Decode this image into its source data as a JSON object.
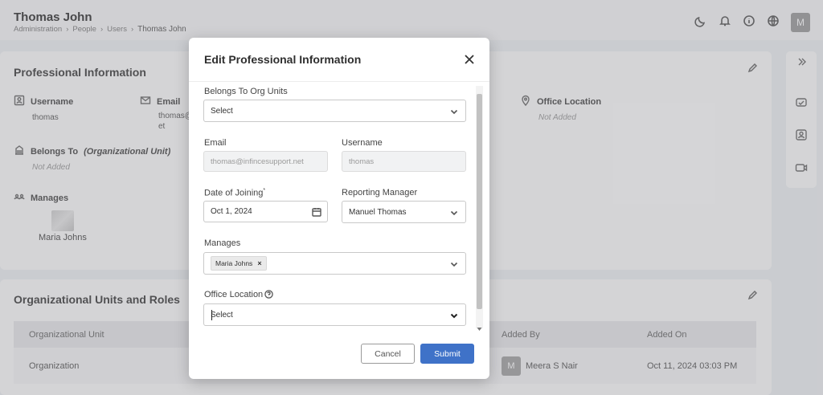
{
  "header": {
    "title": "Thomas John",
    "breadcrumb": [
      "Administration",
      "People",
      "Users",
      "Thomas John"
    ],
    "avatar_initial": "M"
  },
  "professional_info": {
    "heading": "Professional Information",
    "username_label": "Username",
    "username_value": "thomas",
    "email_label": "Email",
    "email_value_line1": "thomas@",
    "email_value_line2": "et",
    "office_location_label": "Office Location",
    "office_location_value": "Not Added",
    "belongs_to_label": "Belongs To",
    "belongs_to_sub": "(Organizational Unit)",
    "belongs_to_value": "Not Added",
    "manages_label": "Manages",
    "manages_name": "Maria Johns"
  },
  "org_units": {
    "heading": "Organizational Units and Roles",
    "columns": [
      "Organizational Unit",
      "Added By",
      "Added On"
    ],
    "row": {
      "unit": "Organization",
      "added_by_initial": "M",
      "added_by": "Meera S Nair",
      "added_on": "Oct 11, 2024 03:03 PM"
    }
  },
  "modal": {
    "title": "Edit Professional Information",
    "belongs_to_label": "Belongs To Org Units",
    "belongs_to_value": "Select",
    "email_label": "Email",
    "email_value": "thomas@infincesupport.net",
    "username_label": "Username",
    "username_value": "thomas",
    "doj_label": "Date of Joining",
    "doj_required": "*",
    "doj_value": "Oct 1, 2024",
    "reporting_label": "Reporting Manager",
    "reporting_value": "Manuel Thomas",
    "manages_label": "Manages",
    "manages_chip": "Maria Johns",
    "chip_remove": "×",
    "office_label": "Office Location",
    "office_value": "Select",
    "cancel_label": "Cancel",
    "submit_label": "Submit"
  },
  "colors": {
    "accent": "#3f72c8",
    "overlay": "#808087"
  }
}
